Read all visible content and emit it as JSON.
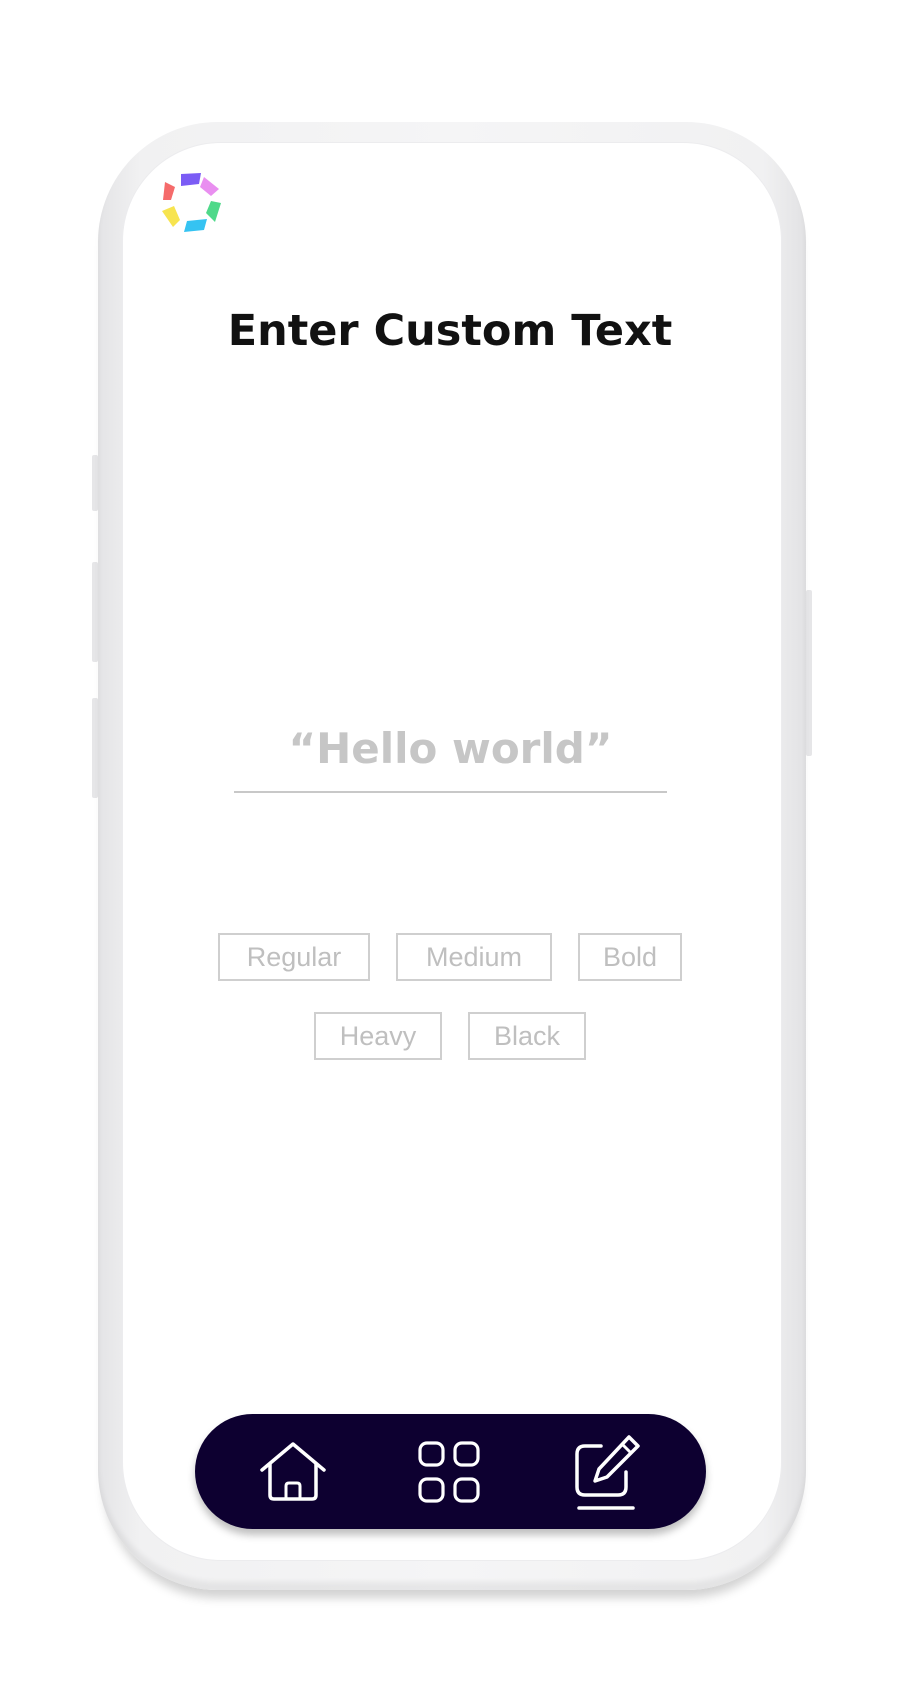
{
  "screen": {
    "title": "Enter Custom Text"
  },
  "text_input": {
    "placeholder": "“Hello world”",
    "value": ""
  },
  "weights": [
    {
      "label": "Regular"
    },
    {
      "label": "Medium"
    },
    {
      "label": "Bold"
    },
    {
      "label": "Heavy"
    },
    {
      "label": "Black"
    }
  ],
  "logo": {
    "icon": "colorful-pinwheel-logo",
    "colors": [
      "#7b5cf5",
      "#e98ff0",
      "#4fd98a",
      "#35c3f2",
      "#f7e44f",
      "#f56b6b"
    ]
  },
  "nav": {
    "background": "#0d0030",
    "icon_color": "#ffffff",
    "items": [
      {
        "icon": "home-icon"
      },
      {
        "icon": "grid-icon"
      },
      {
        "icon": "edit-icon",
        "active": true
      }
    ]
  }
}
